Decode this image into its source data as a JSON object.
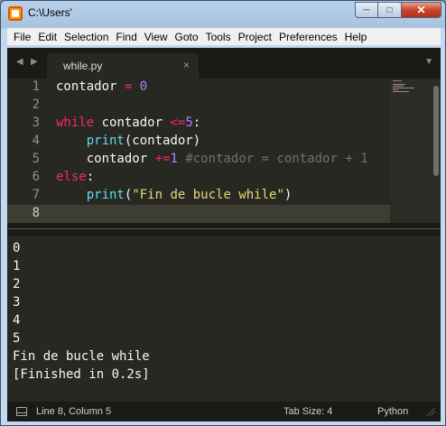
{
  "window": {
    "title": "C:\\Users'"
  },
  "menu": [
    "File",
    "Edit",
    "Selection",
    "Find",
    "View",
    "Goto",
    "Tools",
    "Project",
    "Preferences",
    "Help"
  ],
  "tab": {
    "label": "while.py",
    "close": "×"
  },
  "editor": {
    "line_numbers": [
      "1",
      "2",
      "3",
      "4",
      "5",
      "6",
      "7",
      "8"
    ],
    "current_line": 8
  },
  "output": {
    "lines": [
      "0",
      "1",
      "2",
      "3",
      "4",
      "5",
      "Fin de bucle while",
      "[Finished in 0.2s]"
    ]
  },
  "status": {
    "position": "Line 8, Column 5",
    "tab_size": "Tab Size: 4",
    "syntax": "Python"
  },
  "colors": {
    "editor_bg": "#272822",
    "keyword": "#f92672",
    "number": "#ae81ff",
    "function": "#66d9ef",
    "string": "#e6db74",
    "comment": "#75715e"
  }
}
